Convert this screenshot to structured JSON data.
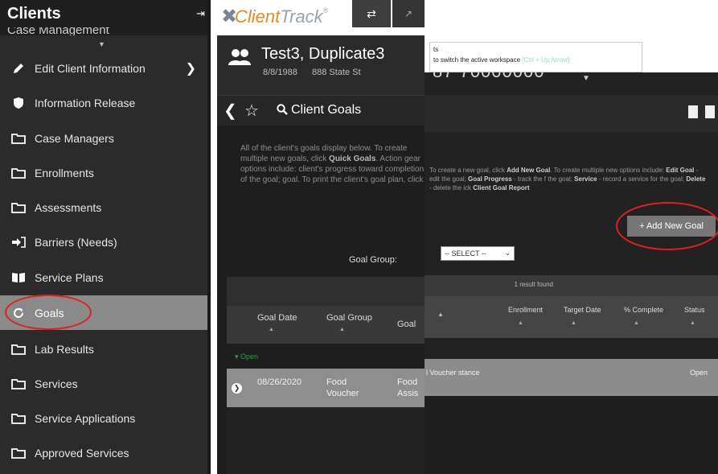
{
  "sidebar": {
    "title": "Clients",
    "subtitle": "Case Management",
    "items": [
      {
        "label": "Edit Client Information",
        "icon": "pencil-icon"
      },
      {
        "label": "Information Release",
        "icon": "shield-icon"
      },
      {
        "label": "Case Managers",
        "icon": "folder-icon"
      },
      {
        "label": "Enrollments",
        "icon": "folder-icon"
      },
      {
        "label": "Assessments",
        "icon": "folder-icon"
      },
      {
        "label": "Barriers (Needs)",
        "icon": "sign-in-icon"
      },
      {
        "label": "Service Plans",
        "icon": "book-icon"
      },
      {
        "label": "Goals",
        "icon": "refresh-icon"
      },
      {
        "label": "Lab Results",
        "icon": "folder-icon"
      },
      {
        "label": "Services",
        "icon": "folder-icon"
      },
      {
        "label": "Service Applications",
        "icon": "folder-icon"
      },
      {
        "label": "Approved Services",
        "icon": "folder-icon"
      }
    ]
  },
  "app": {
    "logo_main": "Client",
    "logo_light": "Track",
    "logo_mark": "®"
  },
  "client": {
    "name": "Test3, Duplicate3",
    "dob": "8/8/1988",
    "address": "888 State St"
  },
  "page": {
    "title": "Client Goals"
  },
  "description": {
    "p1": "All of the client's goals display below.",
    "p2": "To create multiple new goals, click",
    "quick_goals": "Quick Goals",
    "p3": ". Action gear options include:",
    "p4": "client's progress toward completion of the goal;",
    "p5": "goal.  To print the client's goal plan, click"
  },
  "right_description": {
    "s1": "To create a new goal, click",
    "add_new_goal": "Add New Goal",
    "s2": ". To create multiple new",
    "s3": "options include:",
    "edit_goal": "Edit Goal",
    "s4": "- edit the goal;",
    "goal_progress": "Goal Progress",
    "s5": "- track the",
    "s6": "f the goal;",
    "service": "Service",
    "s7": "- record a service for the goal;",
    "delete": "Delete",
    "s8": "- delete the",
    "s9": "ick",
    "report": "Client Goal Report"
  },
  "tooltip": {
    "line1": "ts",
    "line2": "to switch the active workspace",
    "shortcut": "[Ctrl + Up Arrow]"
  },
  "right_header": {
    "mrn": "87 70000000"
  },
  "filters": {
    "goal_group_label": "Goal Group:",
    "goal_group_value": "-- SELECT --"
  },
  "buttons": {
    "add_new_goal": "+ Add New Goal"
  },
  "table": {
    "result_count": "1 result found",
    "headers_mid": [
      "Goal Date",
      "Goal Group",
      "Goal"
    ],
    "headers_right": [
      "Enrollment",
      "Target Date",
      "% Complete",
      "Status"
    ],
    "group_label": "Open",
    "row": {
      "goal_date": "08/26/2020",
      "goal_group": "Food Voucher",
      "goal_mid": "Food Assis",
      "goal_right": "l Voucher stance",
      "status": "Open"
    }
  },
  "colors": {
    "annotation": "#e02020",
    "logo_orange": "#e48a1f",
    "open_green": "#2f9e3a"
  }
}
